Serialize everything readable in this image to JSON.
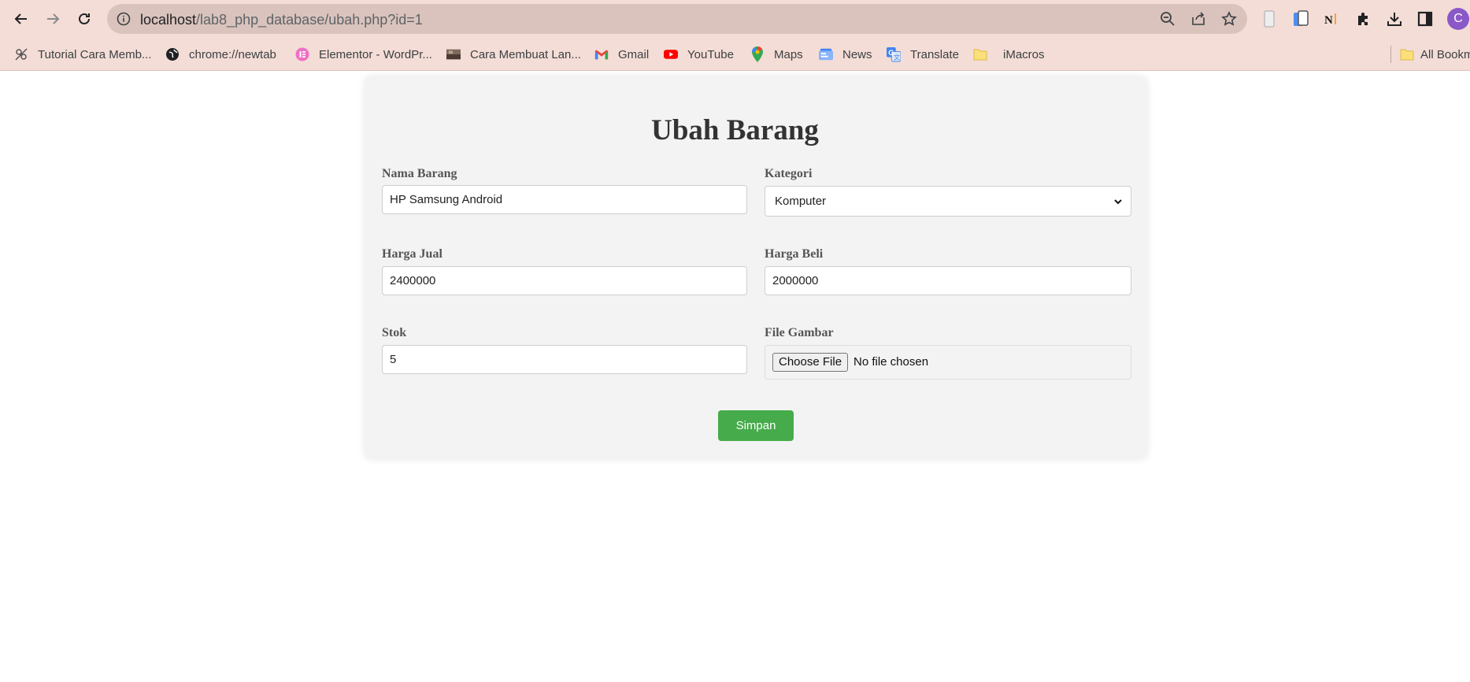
{
  "browser": {
    "url_host": "localhost",
    "url_path": "/lab8_php_database/ubah.php?id=1",
    "avatar_letter": "C",
    "bookmarks": [
      {
        "label": "Tutorial Cara Memb...",
        "icon": "sewing-icon"
      },
      {
        "label": "chrome://newtab",
        "icon": "globe-icon"
      },
      {
        "label": "Elementor - WordPr...",
        "icon": "elementor-icon"
      },
      {
        "label": "Cara Membuat Lan...",
        "icon": "thumbnail-icon"
      },
      {
        "label": "Gmail",
        "icon": "gmail-icon"
      },
      {
        "label": "YouTube",
        "icon": "youtube-icon"
      },
      {
        "label": "Maps",
        "icon": "maps-icon"
      },
      {
        "label": "News",
        "icon": "news-icon"
      },
      {
        "label": "Translate",
        "icon": "translate-icon"
      },
      {
        "label": "iMacros",
        "icon": "folder-icon"
      },
      {
        "label": "All Bookm",
        "icon": "folder-icon"
      }
    ]
  },
  "form": {
    "title": "Ubah Barang",
    "nama_barang": {
      "label": "Nama Barang",
      "value": "HP Samsung Android"
    },
    "kategori": {
      "label": "Kategori",
      "value": "Komputer"
    },
    "harga_jual": {
      "label": "Harga Jual",
      "value": "2400000"
    },
    "harga_beli": {
      "label": "Harga Beli",
      "value": "2000000"
    },
    "stok": {
      "label": "Stok",
      "value": "5"
    },
    "file_gambar": {
      "label": "File Gambar",
      "button": "Choose File",
      "status": "No file chosen"
    },
    "submit_label": "Simpan"
  },
  "colors": {
    "chrome_bg": "#f4ddd6",
    "omnibox_bg": "#d9c3bc",
    "submit_green": "#46ab4a",
    "card_bg": "#f3f3f3"
  }
}
